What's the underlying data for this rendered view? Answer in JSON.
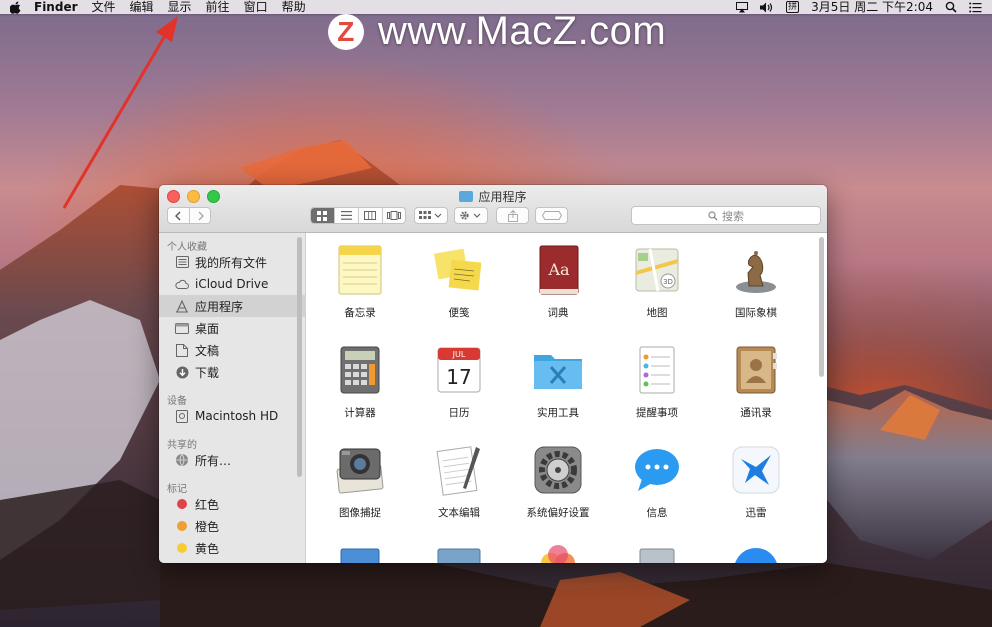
{
  "menubar": {
    "app_name": "Finder",
    "menus": [
      "文件",
      "编辑",
      "显示",
      "前往",
      "窗口",
      "帮助"
    ],
    "ime": "拼",
    "datetime": "3月5日 周二 下午2:04"
  },
  "watermark": {
    "logo_letter": "Z",
    "text": "www.MacZ.com"
  },
  "window": {
    "title": "应用程序",
    "search_placeholder": "搜索"
  },
  "sidebar": {
    "favorites_header": "个人收藏",
    "favorites": [
      "我的所有文件",
      "iCloud Drive",
      "应用程序",
      "桌面",
      "文稿",
      "下载"
    ],
    "devices_header": "设备",
    "devices": [
      "Macintosh HD"
    ],
    "shared_header": "共享的",
    "shared": [
      "所有…"
    ],
    "tags_header": "标记",
    "tags": [
      {
        "label": "红色",
        "color": "#e2414c"
      },
      {
        "label": "橙色",
        "color": "#f0a030"
      },
      {
        "label": "黄色",
        "color": "#f5cc33"
      }
    ]
  },
  "apps": [
    {
      "label": "备忘录",
      "icon": "notes-icon"
    },
    {
      "label": "便笺",
      "icon": "stickies-icon"
    },
    {
      "label": "词典",
      "icon": "dictionary-icon"
    },
    {
      "label": "地图",
      "icon": "maps-icon"
    },
    {
      "label": "国际象棋",
      "icon": "chess-icon"
    },
    {
      "label": "计算器",
      "icon": "calculator-icon"
    },
    {
      "label": "日历",
      "icon": "calendar-icon"
    },
    {
      "label": "实用工具",
      "icon": "utilities-folder-icon"
    },
    {
      "label": "提醒事项",
      "icon": "reminders-icon"
    },
    {
      "label": "通讯录",
      "icon": "contacts-icon"
    },
    {
      "label": "图像捕捉",
      "icon": "image-capture-icon"
    },
    {
      "label": "文本编辑",
      "icon": "textedit-icon"
    },
    {
      "label": "系统偏好设置",
      "icon": "system-preferences-icon"
    },
    {
      "label": "信息",
      "icon": "messages-icon"
    },
    {
      "label": "迅雷",
      "icon": "xunlei-icon"
    }
  ],
  "calendar_icon": {
    "month": "JUL",
    "day": "17"
  },
  "dictionary_icon": {
    "text": "Aa"
  },
  "colors": {
    "folder_blue": "#5aa8dc",
    "selection_gray": "#d2d2d2"
  }
}
